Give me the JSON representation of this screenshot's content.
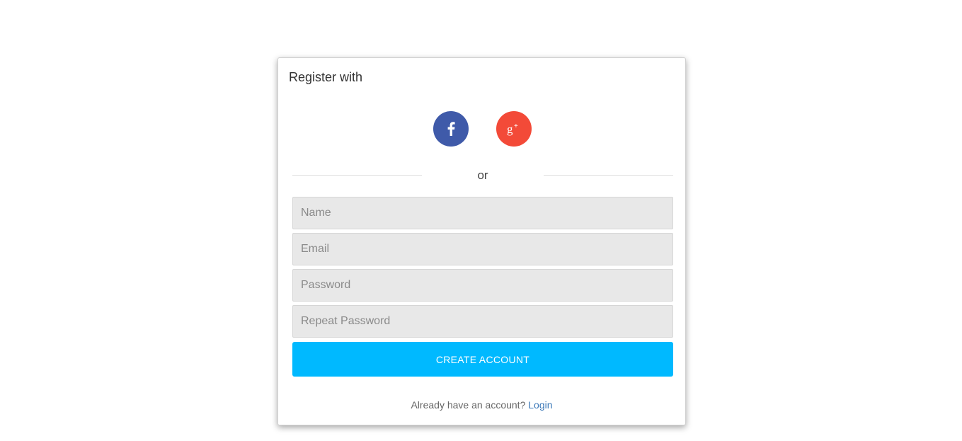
{
  "card": {
    "title": "Register with"
  },
  "social": {
    "facebook": {
      "icon": "facebook-icon",
      "color": "#3f5aa9"
    },
    "google_plus": {
      "icon": "google-plus-icon",
      "color": "#f34a38"
    }
  },
  "divider": {
    "text": "or"
  },
  "form": {
    "name_placeholder": "Name",
    "email_placeholder": "Email",
    "password_placeholder": "Password",
    "repeat_password_placeholder": "Repeat Password",
    "submit_label": "CREATE ACCOUNT",
    "submit_color": "#00b9ff"
  },
  "footer": {
    "prompt": "Already have an account?",
    "login_label": "Login",
    "link_color": "#3b78b8"
  }
}
